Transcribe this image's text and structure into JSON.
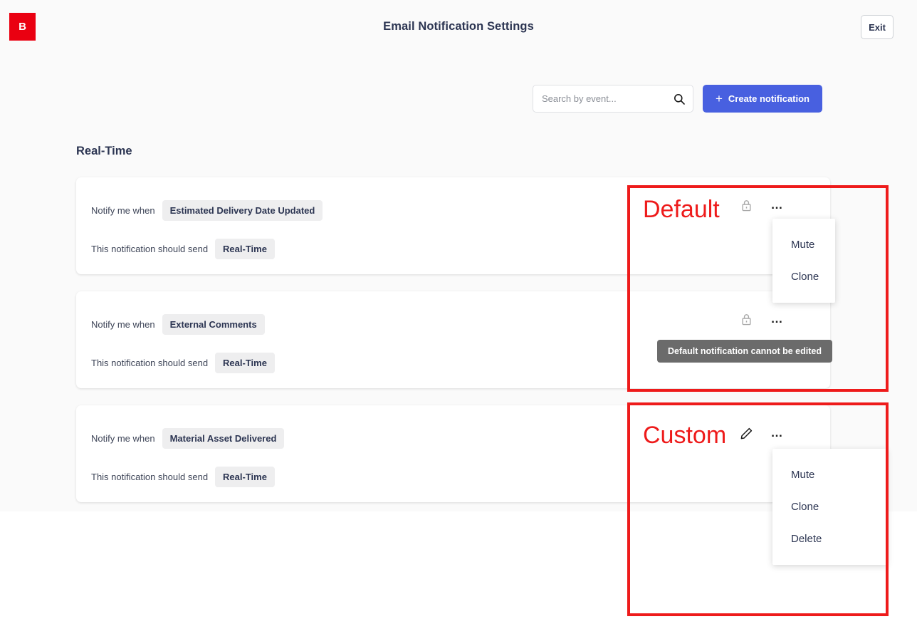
{
  "header": {
    "logo_text": "B",
    "logo_color": "#ea0011",
    "title": "Email Notification Settings",
    "exit_label": "Exit"
  },
  "toolbar": {
    "search_placeholder": "Search by event...",
    "search_value": "",
    "search_icon": "search-icon",
    "create_label": "Create notification",
    "create_plus": "+",
    "accent_color": "#4860e0"
  },
  "sections": [
    {
      "heading": "Real-Time"
    }
  ],
  "labels": {
    "notify_when": "Notify me when",
    "should_send": "This notification should send"
  },
  "cards": [
    {
      "event": "Estimated Delivery Date Updated",
      "frequency": "Real-Time",
      "kind": "default",
      "status_icon": "lock-icon",
      "more_icon": "ellipsis-icon"
    },
    {
      "event": "External Comments",
      "frequency": "Real-Time",
      "kind": "default",
      "status_icon": "lock-icon",
      "more_icon": "ellipsis-icon"
    },
    {
      "event": "Material Asset Delivered",
      "frequency": "Real-Time",
      "kind": "custom",
      "status_icon": "pencil-icon",
      "more_icon": "ellipsis-icon"
    }
  ],
  "menus": {
    "default": {
      "items": [
        "Mute",
        "Clone"
      ]
    },
    "custom": {
      "items": [
        "Mute",
        "Clone",
        "Delete"
      ]
    }
  },
  "tooltip": {
    "text": "Default notification cannot be edited",
    "background": "#6b6b6b"
  },
  "annotations": {
    "color": "#ee1b1b",
    "default_label": "Default",
    "custom_label": "Custom"
  }
}
